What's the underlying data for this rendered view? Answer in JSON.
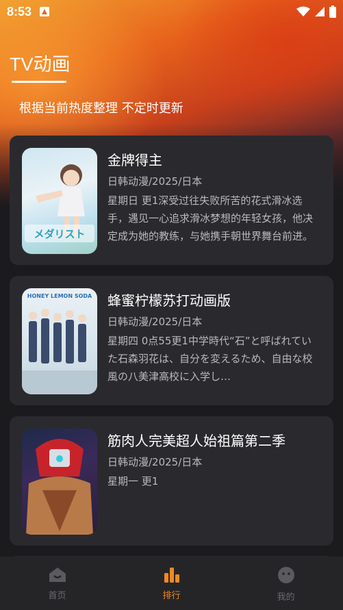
{
  "status_bar": {
    "time": "8:53"
  },
  "header": {
    "title": "TV动画",
    "subtitle": "根据当前热度整理 不定时更新"
  },
  "items": [
    {
      "title": "金牌得主",
      "meta": "日韩动漫/2025/日本",
      "desc": "星期日 更1深受过往失败所苦的花式滑冰选手，遇见一心追求滑冰梦想的年轻女孩，他决定成为她的教练，与她携手朝世界舞台前进。",
      "cover_text": "メダリスト"
    },
    {
      "title": "蜂蜜柠檬苏打动画版",
      "meta": "日韩动漫/2025/日本",
      "desc": "星期四 0点55更1中学時代“石”と呼ばれていた石森羽花は、自分を変えるため、自由な校風の八美津高校に入学し…",
      "cover_text": "HONEY LEMON SODA"
    },
    {
      "title": "筋肉人完美超人始祖篇第二季",
      "meta": "日韩动漫/2025/日本",
      "desc": "星期一 更1",
      "cover_text": ""
    }
  ],
  "tabbar": {
    "tabs": [
      {
        "label": "首页",
        "icon": "home-icon",
        "active": false
      },
      {
        "label": "排行",
        "icon": "chart-icon",
        "active": true
      },
      {
        "label": "我的",
        "icon": "profile-icon",
        "active": false
      }
    ]
  },
  "colors": {
    "accent": "#f08a1e",
    "card": "#2a2a2e",
    "background": "#1b1b1e"
  }
}
